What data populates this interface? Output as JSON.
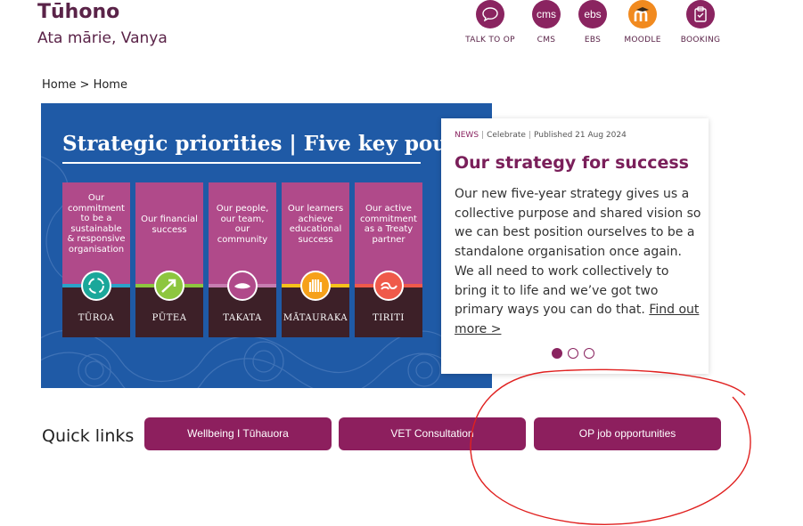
{
  "header": {
    "site_title": "Tūhono",
    "greeting": "Ata mārie, Vanya"
  },
  "toolbar": [
    {
      "glyph": "",
      "icon": "chat-bubble-icon",
      "label": "TALK TO OP"
    },
    {
      "glyph": "cms",
      "icon": "cms-icon",
      "label": "CMS"
    },
    {
      "glyph": "ebs",
      "icon": "ebs-icon",
      "label": "EBS"
    },
    {
      "glyph": "m",
      "icon": "moodle-icon",
      "label": "MOODLE"
    },
    {
      "glyph": "",
      "icon": "booking-clipboard-icon",
      "label": "BOOKING"
    }
  ],
  "breadcrumb": {
    "items": [
      "Home",
      "Home"
    ],
    "separator": ">"
  },
  "banner": {
    "title": "Strategic priorities | Five key pou",
    "pou": [
      {
        "text": "Our commitment to be a sustainable & responsive organisation",
        "name": "TŪROA",
        "icon": "cycle-icon",
        "icon_color": "#1aa79a",
        "line_color": "#2aa3c8"
      },
      {
        "text": "Our financial success",
        "name": "PŪTEA",
        "icon": "growth-arrow-icon",
        "icon_color": "#8dc63f",
        "line_color": "#8dc63f"
      },
      {
        "text": "Our people, our team, our community",
        "name": "TAKATA",
        "icon": "people-icon",
        "icon_color": "#b04a8a",
        "line_color": "#c77db0"
      },
      {
        "text": "Our learners achieve educational success",
        "name": "MĀTAURAKA",
        "icon": "hands-icon",
        "icon_color": "#f6a11a",
        "line_color": "#f6c21a"
      },
      {
        "text": "Our active commitment as a Treaty partner",
        "name": "TIRITI",
        "icon": "koru-icon",
        "icon_color": "#ef5a4a",
        "line_color": "#ef5a4a"
      }
    ]
  },
  "news": {
    "category": "NEWS",
    "tag": "Celebrate",
    "published": "Published 21 Aug 2024",
    "title": "Our strategy for success",
    "body": "Our new five-year strategy gives us a collective purpose and shared vision so we can best position ourselves to be a standalone organisation once again. We all need to work collectively to bring it to life and we’ve got two primary ways you can do that.",
    "link_text": "Find out more >",
    "slides": 3,
    "active_slide": 1
  },
  "quick_links": {
    "label": "Quick links",
    "items": [
      "Wellbeing I Tūhauora",
      "VET Consultation",
      "OP job opportunities"
    ]
  },
  "colors": {
    "brand": "#8d1f5e",
    "banner_blue": "#1f5aa6",
    "annotation_red": "#e0201f"
  }
}
